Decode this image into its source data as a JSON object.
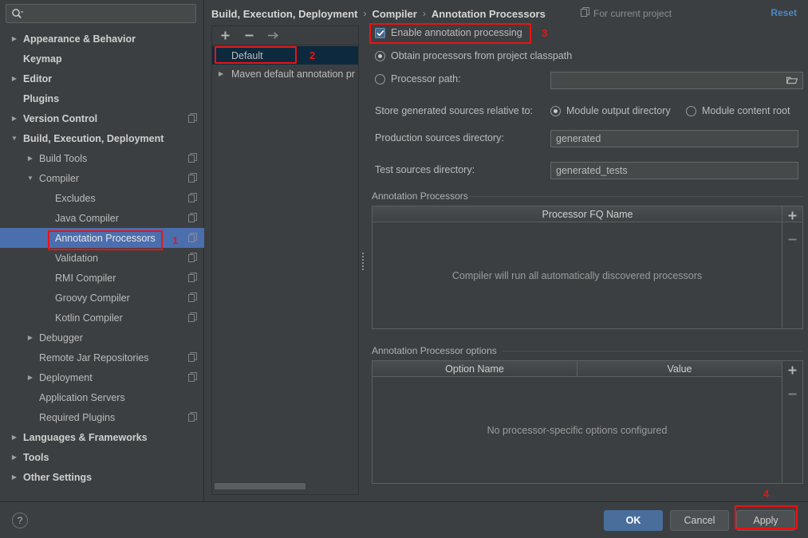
{
  "window": {
    "title": "Settings"
  },
  "sidebar": {
    "search": {
      "value": "",
      "placeholder": ""
    },
    "items": [
      {
        "label": "Appearance & Behavior",
        "indent": 0,
        "arrow": "right",
        "bold": true,
        "copy": false,
        "selected": false
      },
      {
        "label": "Keymap",
        "indent": 0,
        "arrow": "none",
        "bold": true,
        "copy": false,
        "selected": false
      },
      {
        "label": "Editor",
        "indent": 0,
        "arrow": "right",
        "bold": true,
        "copy": false,
        "selected": false
      },
      {
        "label": "Plugins",
        "indent": 0,
        "arrow": "none",
        "bold": true,
        "copy": false,
        "selected": false
      },
      {
        "label": "Version Control",
        "indent": 0,
        "arrow": "right",
        "bold": true,
        "copy": true,
        "selected": false
      },
      {
        "label": "Build, Execution, Deployment",
        "indent": 0,
        "arrow": "down",
        "bold": true,
        "copy": false,
        "selected": false
      },
      {
        "label": "Build Tools",
        "indent": 1,
        "arrow": "right",
        "bold": false,
        "copy": true,
        "selected": false
      },
      {
        "label": "Compiler",
        "indent": 1,
        "arrow": "down",
        "bold": false,
        "copy": true,
        "selected": false
      },
      {
        "label": "Excludes",
        "indent": 2,
        "arrow": "none",
        "bold": false,
        "copy": true,
        "selected": false
      },
      {
        "label": "Java Compiler",
        "indent": 2,
        "arrow": "none",
        "bold": false,
        "copy": true,
        "selected": false
      },
      {
        "label": "Annotation Processors",
        "indent": 2,
        "arrow": "none",
        "bold": false,
        "copy": true,
        "selected": true
      },
      {
        "label": "Validation",
        "indent": 2,
        "arrow": "none",
        "bold": false,
        "copy": true,
        "selected": false
      },
      {
        "label": "RMI Compiler",
        "indent": 2,
        "arrow": "none",
        "bold": false,
        "copy": true,
        "selected": false
      },
      {
        "label": "Groovy Compiler",
        "indent": 2,
        "arrow": "none",
        "bold": false,
        "copy": true,
        "selected": false
      },
      {
        "label": "Kotlin Compiler",
        "indent": 2,
        "arrow": "none",
        "bold": false,
        "copy": true,
        "selected": false
      },
      {
        "label": "Debugger",
        "indent": 1,
        "arrow": "right",
        "bold": false,
        "copy": false,
        "selected": false
      },
      {
        "label": "Remote Jar Repositories",
        "indent": 1,
        "arrow": "none",
        "bold": false,
        "copy": true,
        "selected": false
      },
      {
        "label": "Deployment",
        "indent": 1,
        "arrow": "right",
        "bold": false,
        "copy": true,
        "selected": false
      },
      {
        "label": "Application Servers",
        "indent": 1,
        "arrow": "none",
        "bold": false,
        "copy": false,
        "selected": false
      },
      {
        "label": "Required Plugins",
        "indent": 1,
        "arrow": "none",
        "bold": false,
        "copy": true,
        "selected": false
      },
      {
        "label": "Languages & Frameworks",
        "indent": 0,
        "arrow": "right",
        "bold": true,
        "copy": false,
        "selected": false
      },
      {
        "label": "Tools",
        "indent": 0,
        "arrow": "right",
        "bold": true,
        "copy": false,
        "selected": false
      },
      {
        "label": "Other Settings",
        "indent": 0,
        "arrow": "right",
        "bold": true,
        "copy": false,
        "selected": false
      }
    ]
  },
  "header": {
    "breadcrumb": [
      "Build, Execution, Deployment",
      "Compiler",
      "Annotation Processors"
    ],
    "separator": "›",
    "scope_label": "For current project",
    "reset_label": "Reset"
  },
  "module_panel": {
    "toolbar": {
      "add": "+",
      "remove": "−",
      "move": "→"
    },
    "rows": [
      {
        "label": "Default",
        "arrow": "none",
        "selected": true
      },
      {
        "label": "Maven default annotation pr",
        "arrow": "right",
        "selected": false
      }
    ]
  },
  "main": {
    "enable_processing": {
      "label": "Enable annotation processing",
      "checked": true
    },
    "source_mode": {
      "options": [
        {
          "label": "Obtain processors from project classpath",
          "selected": true
        },
        {
          "label": "Processor path:",
          "selected": false
        }
      ],
      "processor_path_value": ""
    },
    "store_relative": {
      "label": "Store generated sources relative to:",
      "options": [
        {
          "label": "Module output directory",
          "selected": true
        },
        {
          "label": "Module content root",
          "selected": false
        }
      ]
    },
    "production_sources": {
      "label": "Production sources directory:",
      "value": "generated"
    },
    "test_sources": {
      "label": "Test sources directory:",
      "value": "generated_tests"
    },
    "processors_group": {
      "title": "Annotation Processors",
      "columns": [
        "Processor FQ Name"
      ],
      "rows": [],
      "empty_message": "Compiler will run all automatically discovered processors",
      "buttons": {
        "add": "+",
        "remove": "−"
      }
    },
    "options_group": {
      "title": "Annotation Processor options",
      "columns": [
        "Option Name",
        "Value"
      ],
      "rows": [],
      "empty_message": "No processor-specific options configured",
      "buttons": {
        "add": "+",
        "remove": "−"
      }
    }
  },
  "footer": {
    "help": "?",
    "ok": "OK",
    "cancel": "Cancel",
    "apply": "Apply"
  },
  "annotations": [
    {
      "num": "1"
    },
    {
      "num": "2"
    },
    {
      "num": "3"
    },
    {
      "num": "4"
    }
  ],
  "colors": {
    "background": "#3c3f41",
    "selection_blue": "#4b6eaf",
    "list_selection": "#0d293e",
    "accent_link": "#4a88c7",
    "primary_button": "#4a6e9c",
    "annotation_red": "#ee1111",
    "checkbox_blue": "#43698f"
  }
}
